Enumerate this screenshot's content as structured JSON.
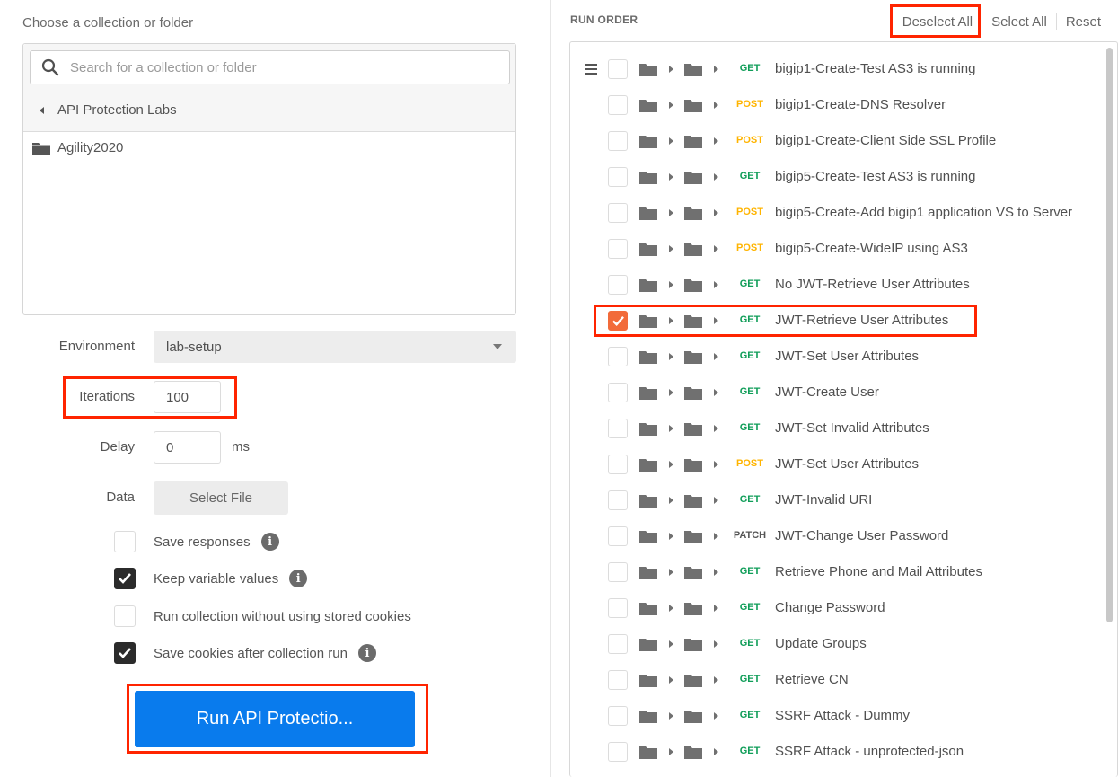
{
  "left": {
    "choose_label": "Choose a collection or folder",
    "search_placeholder": "Search for a collection or folder",
    "back_label": "API Protection Labs",
    "folder_label": "Agility2020",
    "environment_label": "Environment",
    "environment_value": "lab-setup",
    "iterations_label": "Iterations",
    "iterations_value": "100",
    "delay_label": "Delay",
    "delay_value": "0",
    "delay_unit": "ms",
    "data_label": "Data",
    "select_file_label": "Select File",
    "options": [
      {
        "label": "Save responses",
        "checked": false,
        "info": true
      },
      {
        "label": "Keep variable values",
        "checked": true,
        "info": true
      },
      {
        "label": "Run collection without using stored cookies",
        "checked": false,
        "info": false
      },
      {
        "label": "Save cookies after collection run",
        "checked": true,
        "info": true
      }
    ],
    "run_button": "Run API Protectio..."
  },
  "right": {
    "run_order_label": "RUN ORDER",
    "deselect_all": "Deselect All",
    "select_all": "Select All",
    "reset": "Reset",
    "requests": [
      {
        "method": "GET",
        "name": "bigip1-Create-Test AS3 is running",
        "checked": false
      },
      {
        "method": "POST",
        "name": "bigip1-Create-DNS Resolver",
        "checked": false
      },
      {
        "method": "POST",
        "name": "bigip1-Create-Client Side SSL Profile",
        "checked": false
      },
      {
        "method": "GET",
        "name": "bigip5-Create-Test AS3 is running",
        "checked": false
      },
      {
        "method": "POST",
        "name": "bigip5-Create-Add bigip1 application VS to Server",
        "checked": false
      },
      {
        "method": "POST",
        "name": "bigip5-Create-WideIP using AS3",
        "checked": false
      },
      {
        "method": "GET",
        "name": "No JWT-Retrieve User Attributes",
        "checked": false
      },
      {
        "method": "GET",
        "name": "JWT-Retrieve User Attributes",
        "checked": true
      },
      {
        "method": "GET",
        "name": "JWT-Set User Attributes",
        "checked": false
      },
      {
        "method": "GET",
        "name": "JWT-Create User",
        "checked": false
      },
      {
        "method": "GET",
        "name": "JWT-Set Invalid Attributes",
        "checked": false
      },
      {
        "method": "POST",
        "name": "JWT-Set User Attributes",
        "checked": false
      },
      {
        "method": "GET",
        "name": "JWT-Invalid URI",
        "checked": false
      },
      {
        "method": "PATCH",
        "name": "JWT-Change User Password",
        "checked": false
      },
      {
        "method": "GET",
        "name": "Retrieve Phone and Mail Attributes",
        "checked": false
      },
      {
        "method": "GET",
        "name": "Change Password",
        "checked": false
      },
      {
        "method": "GET",
        "name": "Update Groups",
        "checked": false
      },
      {
        "method": "GET",
        "name": "Retrieve CN",
        "checked": false
      },
      {
        "method": "GET",
        "name": "SSRF Attack - Dummy",
        "checked": false
      },
      {
        "method": "GET",
        "name": "SSRF Attack - unprotected-json",
        "checked": false
      }
    ]
  },
  "colors": {
    "highlight": "#ff2400",
    "run_button": "#097bed",
    "checked_request": "#f26b3a",
    "get": "#0f9d58",
    "post": "#ffb400"
  }
}
